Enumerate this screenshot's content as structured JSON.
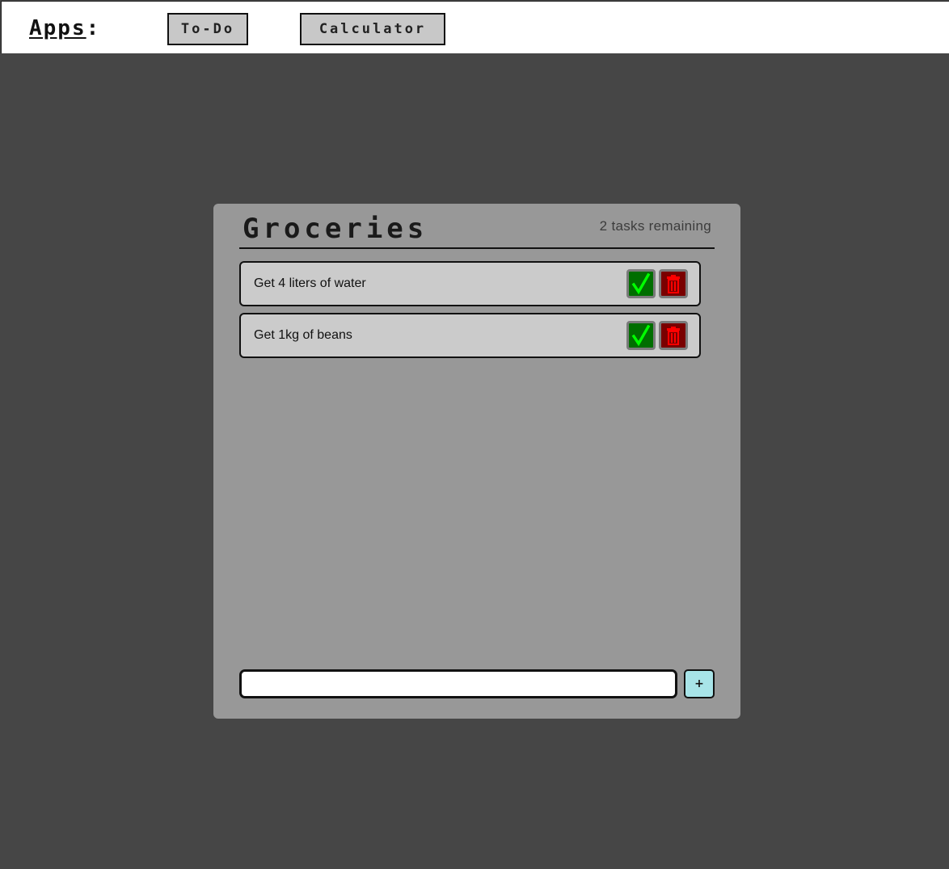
{
  "header": {
    "apps_label": "Apps",
    "apps_colon": ":",
    "nav": [
      {
        "label": "To-Do"
      },
      {
        "label": "Calculator"
      }
    ]
  },
  "todo": {
    "title": "Groceries",
    "remaining": "2 tasks remaining",
    "tasks": [
      {
        "text": "Get 4 liters of water",
        "check_icon": "checkmark-icon",
        "delete_icon": "trash-icon"
      },
      {
        "text": "Get 1kg of beans",
        "check_icon": "checkmark-icon",
        "delete_icon": "trash-icon"
      }
    ],
    "new_task_value": "",
    "add_label": "+"
  },
  "colors": {
    "page_background": "#464646",
    "panel_background": "#989898",
    "task_background": "#cbcbcb",
    "check_button": "#006e00",
    "check_mark": "#00ff00",
    "delete_button": "#7a0000",
    "trash_icon": "#ff0000",
    "add_button": "#a8e4e8",
    "nav_button": "#c8c8c8"
  }
}
